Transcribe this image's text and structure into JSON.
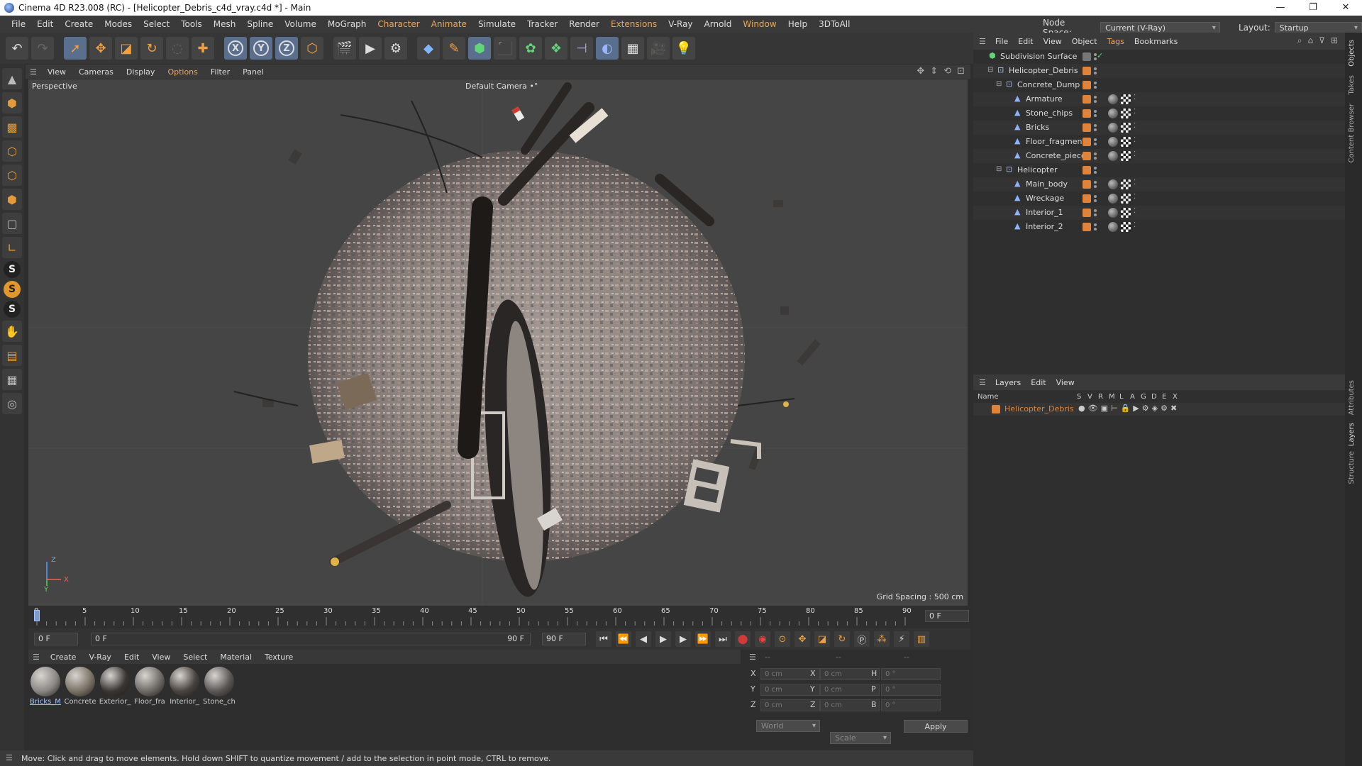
{
  "window": {
    "title": "Cinema 4D R23.008 (RC) - [Helicopter_Debris_c4d_vray.c4d *] - Main",
    "controls": [
      "—",
      "❐",
      "✕"
    ]
  },
  "menubar": {
    "items": [
      "File",
      "Edit",
      "Create",
      "Modes",
      "Select",
      "Tools",
      "Mesh",
      "Spline",
      "Volume",
      "MoGraph",
      "Character",
      "Animate",
      "Simulate",
      "Tracker",
      "Render",
      "Extensions",
      "V-Ray",
      "Arnold",
      "Window",
      "Help",
      "3DToAll"
    ],
    "node_space_label": "Node Space:",
    "node_space_value": "Current (V-Ray)",
    "layout_label": "Layout:",
    "layout_value": "Startup"
  },
  "toolbar": {
    "icons": [
      "undo-icon",
      "redo-icon",
      "select-cursor-icon",
      "move-icon",
      "scale-icon",
      "rotate-icon",
      "live-select-icon",
      "add-icon",
      "x-axis-icon",
      "y-axis-icon",
      "z-axis-icon",
      "coordinate-system-icon",
      "render-region-icon",
      "render-view-icon",
      "render-settings-icon",
      "cube-icon",
      "pen-icon",
      "subdivision-icon",
      "extrude-icon",
      "cloner-icon",
      "instance-icon",
      "deformer-icon",
      "field-icon",
      "floor-icon",
      "camera-icon",
      "light-icon"
    ],
    "axis_labels": [
      "X",
      "Y",
      "Z"
    ]
  },
  "viewport": {
    "menu": [
      "View",
      "Cameras",
      "Display",
      "Options",
      "Filter",
      "Panel"
    ],
    "label": "Perspective",
    "camera": "Default Camera",
    "camera_icon": "•°",
    "grid_spacing": "Grid Spacing : 500 cm",
    "axis_labels": [
      "Z",
      "Y",
      "X"
    ]
  },
  "timeline": {
    "ticks": [
      "0",
      "5",
      "10",
      "15",
      "20",
      "25",
      "30",
      "35",
      "40",
      "45",
      "50",
      "55",
      "60",
      "65",
      "70",
      "75",
      "80",
      "85",
      "90"
    ],
    "current_frame": "0 F",
    "start_frame": "0 F",
    "range_start": "0 F",
    "range_end": "90 F",
    "end_frame": "90 F"
  },
  "materials": {
    "menu": [
      "Create",
      "V-Ray",
      "Edit",
      "View",
      "Select",
      "Material",
      "Texture"
    ],
    "items": [
      {
        "label": "Bricks_M",
        "selected": true,
        "color": "#8a8884"
      },
      {
        "label": "Concrete",
        "selected": false,
        "color": "#7a7266"
      },
      {
        "label": "Exterior_",
        "selected": false,
        "color": "#3a3634"
      },
      {
        "label": "Floor_fra",
        "selected": false,
        "color": "#6e6a66"
      },
      {
        "label": "Interior_",
        "selected": false,
        "color": "#4a4440"
      },
      {
        "label": "Stone_ch",
        "selected": false,
        "color": "#5a5856"
      }
    ]
  },
  "coordinates": {
    "header": [
      "--",
      "--",
      "--"
    ],
    "rows": [
      {
        "a": "X",
        "av": "0 cm",
        "b": "X",
        "bv": "0 cm",
        "c": "H",
        "cv": "0 °"
      },
      {
        "a": "Y",
        "av": "0 cm",
        "b": "Y",
        "bv": "0 cm",
        "c": "P",
        "cv": "0 °"
      },
      {
        "a": "Z",
        "av": "0 cm",
        "b": "Z",
        "bv": "0 cm",
        "c": "B",
        "cv": "0 °"
      }
    ],
    "mode": "World",
    "scale": "Scale",
    "apply": "Apply"
  },
  "status": "Move: Click and drag to move elements. Hold down SHIFT to quantize movement / add to the selection in point mode, CTRL to remove.",
  "objects": {
    "menu": [
      "File",
      "Edit",
      "View",
      "Object",
      "Tags",
      "Bookmarks"
    ],
    "rows": [
      {
        "name": "Subdivision Surface",
        "level": 0,
        "type": "subdivision",
        "check": "✓"
      },
      {
        "name": "Helicopter_Debris",
        "level": 1,
        "type": "null"
      },
      {
        "name": "Concrete_Dump",
        "level": 2,
        "type": "null"
      },
      {
        "name": "Armature",
        "level": 3,
        "type": "mesh"
      },
      {
        "name": "Stone_chips",
        "level": 3,
        "type": "mesh"
      },
      {
        "name": "Bricks",
        "level": 3,
        "type": "mesh"
      },
      {
        "name": "Floor_fragment",
        "level": 3,
        "type": "mesh"
      },
      {
        "name": "Concrete_piece",
        "level": 3,
        "type": "mesh"
      },
      {
        "name": "Helicopter",
        "level": 2,
        "type": "null"
      },
      {
        "name": "Main_body",
        "level": 3,
        "type": "mesh"
      },
      {
        "name": "Wreckage",
        "level": 3,
        "type": "mesh"
      },
      {
        "name": "Interior_1",
        "level": 3,
        "type": "mesh"
      },
      {
        "name": "Interior_2",
        "level": 3,
        "type": "mesh"
      }
    ]
  },
  "layers": {
    "menu": [
      "Layers",
      "Edit",
      "View"
    ],
    "columns": [
      "Name",
      "S",
      "V",
      "R",
      "M",
      "L",
      "A",
      "G",
      "D",
      "E",
      "X"
    ],
    "rows": [
      {
        "name": "Helicopter_Debris",
        "color": "#e0833a"
      }
    ]
  },
  "side_tabs": [
    "Objects",
    "Takes",
    "Content Browser",
    "Attributes",
    "Layers",
    "Structure"
  ],
  "colors": {
    "accent": "#e8a85a",
    "layer_orange": "#e0833a",
    "selection_blue": "#9fc2ff"
  }
}
